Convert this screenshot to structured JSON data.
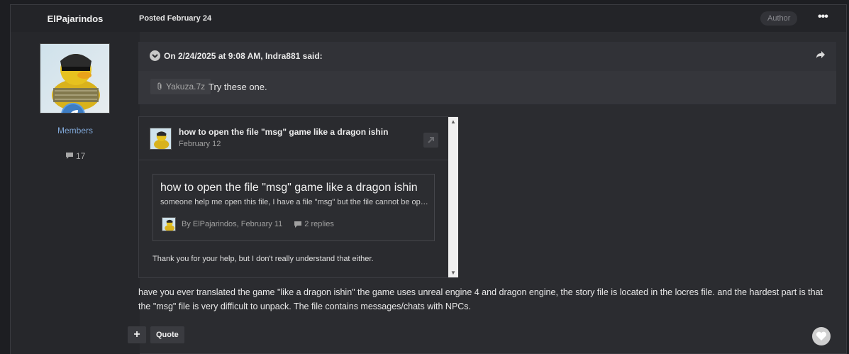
{
  "post": {
    "author": "ElPajarindos",
    "posted": "Posted February 24",
    "author_badge": "Author",
    "menu_label": "•••",
    "group": "Members",
    "post_count": "17"
  },
  "quote": {
    "citation": "On 2/24/2025 at 9:08 AM, Indra881 said:",
    "attachment": "Yakuza.7z",
    "text": "Try these one."
  },
  "embed": {
    "title": "how to open the file \"msg\" game like a dragon ishin",
    "date": "February 12",
    "inner_title": "how to open the file \"msg\" game like a dragon ishin",
    "snippet": "someone help me open this file, I have a file \"msg\" but the file cannot be opened. what is the correct way to open this file?",
    "meta": "By ElPajarindos, February 11",
    "replies": "2 replies",
    "footer": "Thank you for your help, but I don't really understand that either."
  },
  "body_text": "have you ever translated the game \"like a dragon ishin\" the game uses unreal engine 4 and dragon engine, the story file is located in the locres file. and the hardest part is that the \"msg\" file is very difficult to unpack. The file contains messages/chats with NPCs.",
  "actions": {
    "plus": "+",
    "quote": "Quote"
  },
  "icons": {
    "chevron": "chevron-down-icon",
    "share": "share-icon",
    "paperclip": "paperclip-icon",
    "open": "open-external-icon",
    "comment": "comment-icon",
    "heart": "heart-icon",
    "leaf": "leaf-icon"
  },
  "colors": {
    "background": "#1d1e22",
    "panel": "#2b2c30",
    "group_link": "#7fa6d6",
    "rank_badge": "#3d7dc4"
  }
}
